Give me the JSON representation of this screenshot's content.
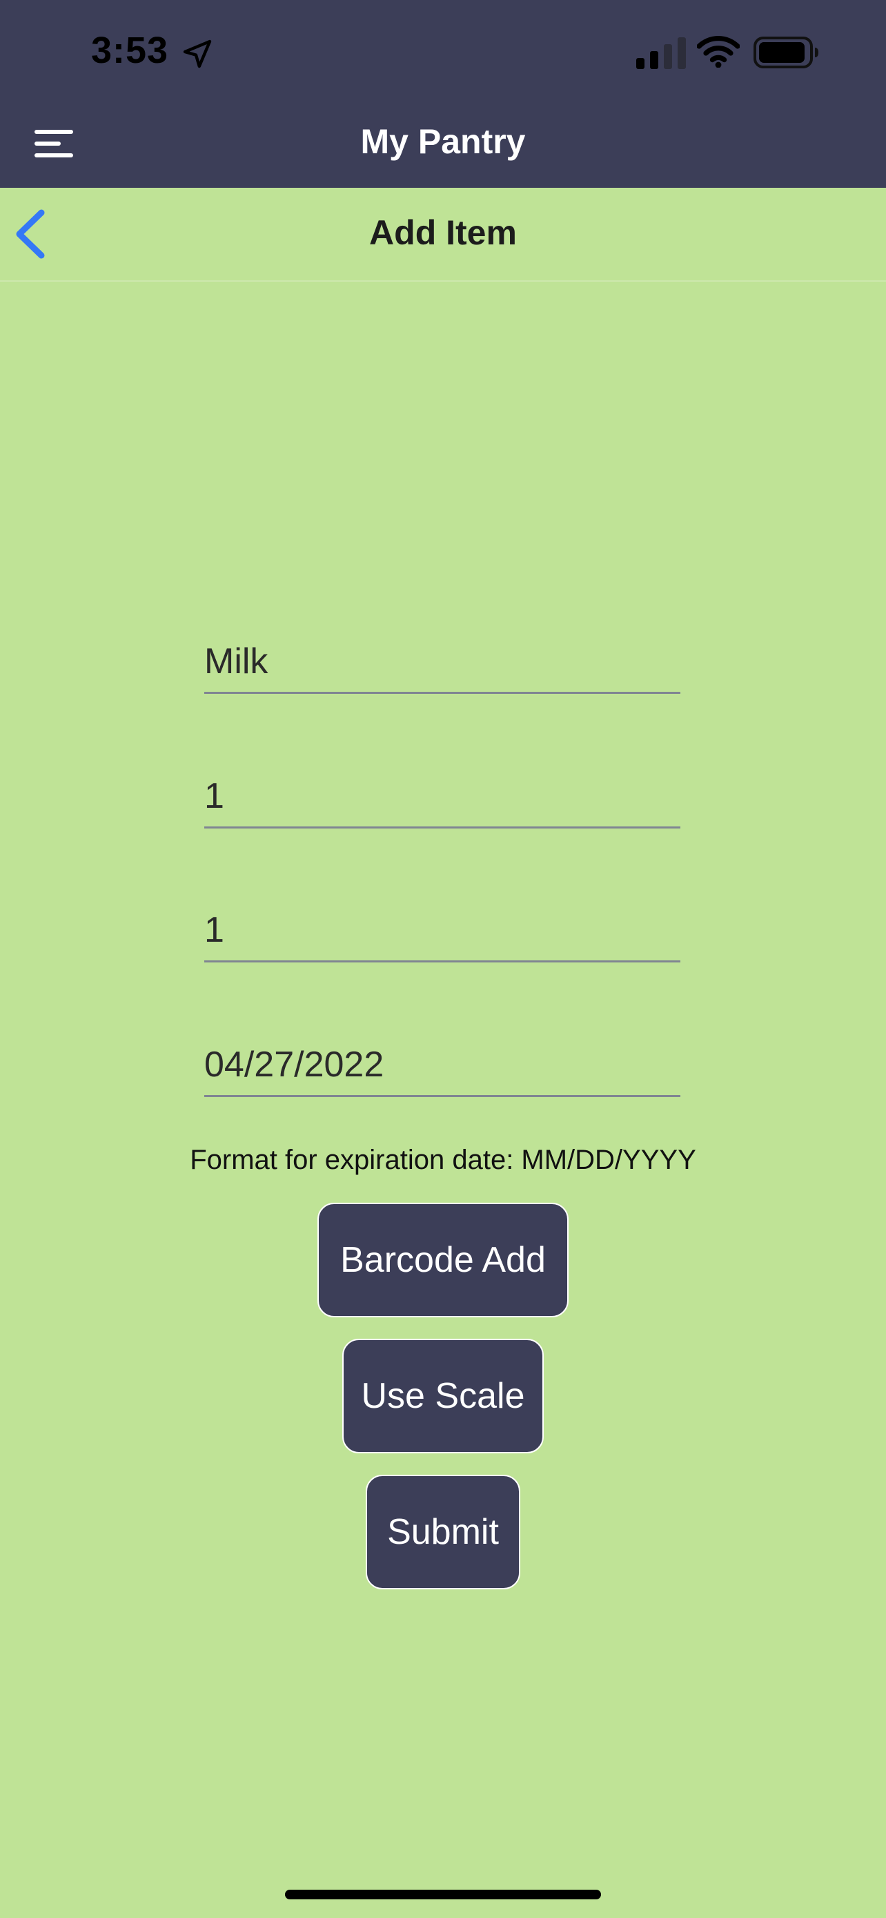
{
  "status_bar": {
    "time": "3:53",
    "icons": [
      "location-arrow-icon",
      "cellular-signal-icon",
      "wifi-icon",
      "battery-icon"
    ]
  },
  "header": {
    "title": "My Pantry",
    "menu_icon": "hamburger-menu-icon",
    "background_color": "#3c3e58"
  },
  "subheader": {
    "title": "Add Item",
    "back_icon": "chevron-left-icon",
    "back_icon_color": "#3478f6"
  },
  "form": {
    "name_value": "Milk",
    "quantity_value": "1",
    "amount_value": "1",
    "expiration_value": "04/27/2022",
    "format_hint": "Format for expiration date: MM/DD/YYYY"
  },
  "buttons": {
    "barcode_label": "Barcode Add",
    "scale_label": "Use Scale",
    "submit_label": "Submit"
  },
  "colors": {
    "page_background": "#bfe396",
    "button_background": "#3c3e58",
    "button_text": "#ffffff"
  }
}
